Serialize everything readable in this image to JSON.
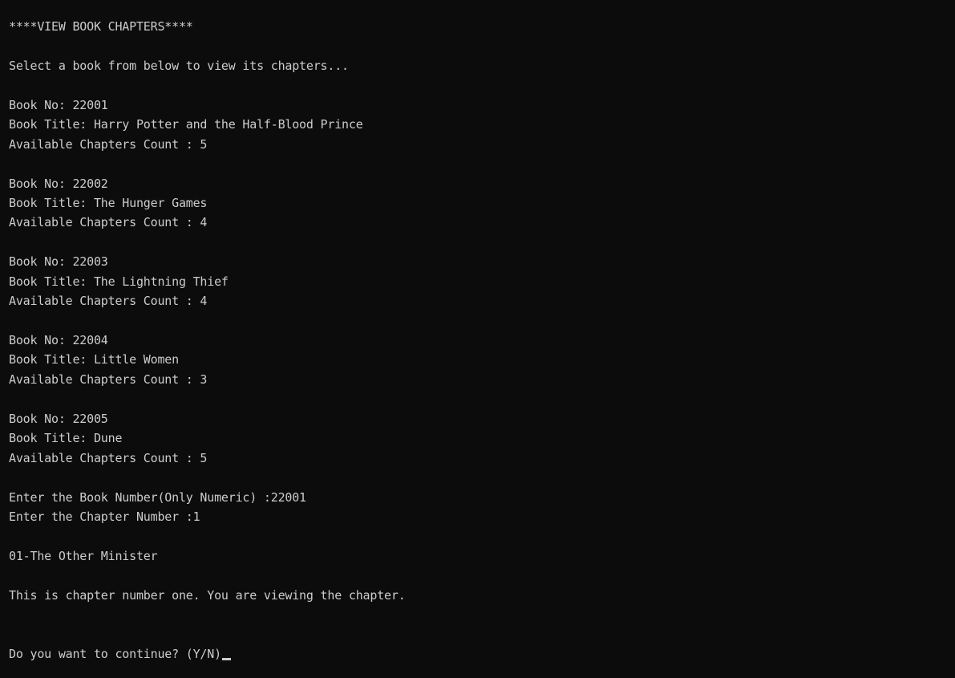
{
  "console": {
    "header": "****VIEW BOOK CHAPTERS****",
    "instruction": "Select a book from below to view its chapters...",
    "books": [
      {
        "number_line": "Book No: 22001",
        "title_line": "Book Title: Harry Potter and the Half-Blood Prince",
        "count_line": "Available Chapters Count : 5"
      },
      {
        "number_line": "Book No: 22002",
        "title_line": "Book Title: The Hunger Games",
        "count_line": "Available Chapters Count : 4"
      },
      {
        "number_line": "Book No: 22003",
        "title_line": "Book Title: The Lightning Thief",
        "count_line": "Available Chapters Count : 4"
      },
      {
        "number_line": "Book No: 22004",
        "title_line": "Book Title: Little Women",
        "count_line": "Available Chapters Count : 3"
      },
      {
        "number_line": "Book No: 22005",
        "title_line": "Book Title: Dune",
        "count_line": "Available Chapters Count : 5"
      }
    ],
    "book_prompt": "Enter the Book Number(Only Numeric) :22001",
    "chapter_prompt": "Enter the Chapter Number :1",
    "chapter_title": "01-The Other Minister",
    "chapter_body": "This is chapter number one. You are viewing the chapter.",
    "continue_prompt": "Do you want to continue? (Y/N)"
  },
  "colors": {
    "background": "#0c0c0c",
    "text": "#cccccc"
  }
}
